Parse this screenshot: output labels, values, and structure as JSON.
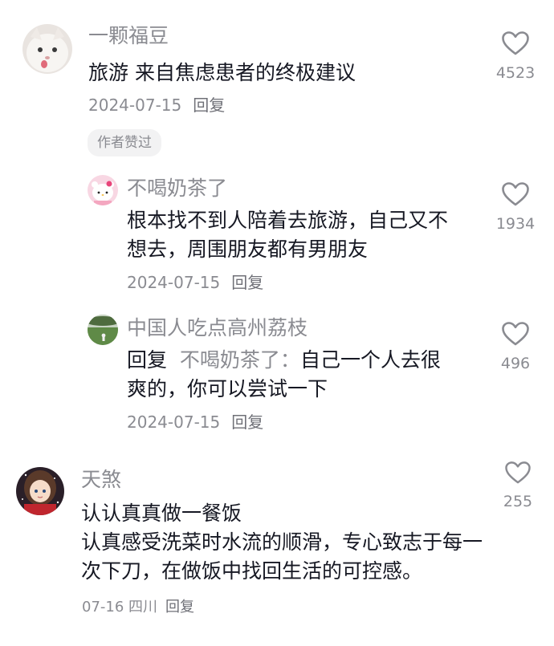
{
  "comments": [
    {
      "username": "一颗福豆",
      "lines": [
        "旅游 来自焦虑患者的终极建议"
      ],
      "date": "2024-07-15",
      "reply_label": "回复",
      "likes": "4523",
      "badge": "作者赞过",
      "avatar": "white-cat-avatar"
    },
    {
      "username": "不喝奶茶了",
      "lines": [
        "根本找不到人陪着去旅游，自己又不",
        "想去，周围朋友都有男朋友"
      ],
      "date": "2024-07-15",
      "reply_label": "回复",
      "likes": "1934",
      "avatar": "hello-kitty-avatar"
    },
    {
      "username": "中国人吃点高州荔枝",
      "reply_prefix": "回复",
      "reply_target": "不喝奶茶了：",
      "line1_rest": "自己一个人去很",
      "line2": "爽的，你可以尝试一下",
      "date": "2024-07-15",
      "reply_label": "回复",
      "likes": "496",
      "avatar": "grass-field-avatar"
    },
    {
      "username": "天煞",
      "lines": [
        "认认真真做一餐饭",
        "认真感受洗菜时水流的顺滑，专心致志于每一",
        "次下刀，在做饭中找回生活的可控感。"
      ],
      "date": "07-16",
      "location": "四川",
      "reply_label": "回复",
      "likes": "255",
      "avatar": "anime-girl-avatar"
    }
  ],
  "colors": {
    "text": "#161823",
    "secondary": "#8a8b91",
    "badge_bg": "#f2f2f3"
  }
}
